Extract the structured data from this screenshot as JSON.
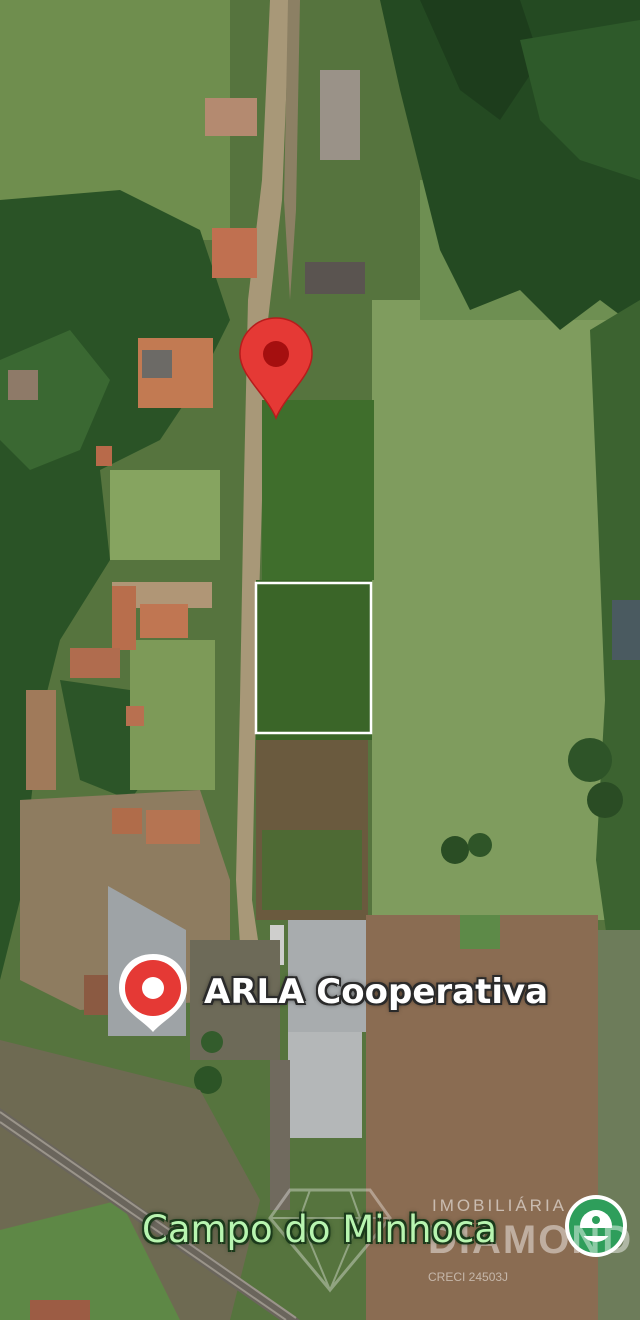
{
  "map": {
    "view": "satellite",
    "poi_label": "ARLA Cooperativa",
    "place_label": "Campo do Minhoca",
    "selected_pin": {
      "icon": "red-location-pin-icon",
      "color": "#e53935"
    },
    "poi_pin": {
      "icon": "poi-marker-icon",
      "color": "#e53935"
    },
    "place_pin": {
      "icon": "green-place-marker-icon",
      "color": "#2e9e5b"
    }
  },
  "watermark": {
    "line1": "IMOBILIÁRIA",
    "line2": "DIAMOND",
    "line3": "CRECI 24503J",
    "logo": "diamond-logo-icon"
  }
}
